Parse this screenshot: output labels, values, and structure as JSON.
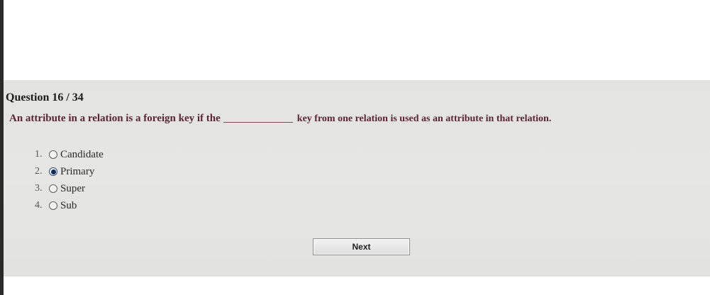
{
  "quiz": {
    "question_header": "Question 16 / 34",
    "question_text_before": "An attribute in a relation is a foreign key if the",
    "question_text_after": "key from one relation is used as an attribute in that relation.",
    "options": [
      {
        "number": "1.",
        "label": "Candidate",
        "selected": false
      },
      {
        "number": "2.",
        "label": "Primary",
        "selected": true
      },
      {
        "number": "3.",
        "label": "Super",
        "selected": false
      },
      {
        "number": "4.",
        "label": "Sub",
        "selected": false
      }
    ],
    "next_label": "Next"
  }
}
